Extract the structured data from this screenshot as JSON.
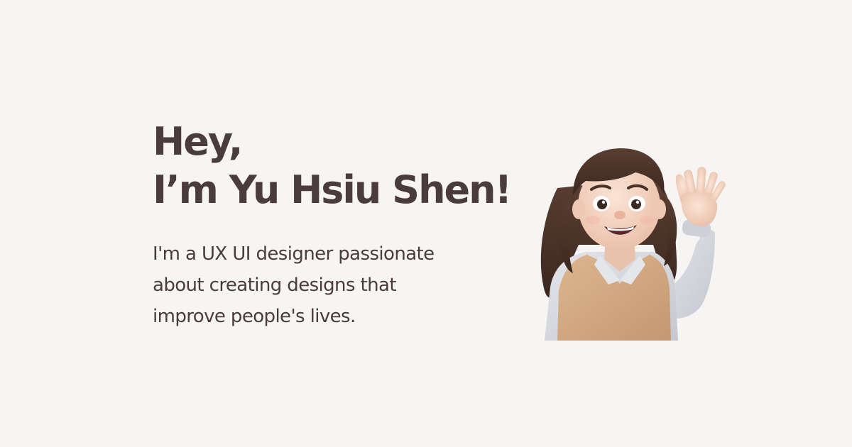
{
  "hero": {
    "greeting_line1": "Hey,",
    "greeting_line2": "I’m Yu Hsiu Shen!",
    "tagline_lines": [
      "I'm a UX UI designer passionate",
      "about creating designs that",
      "improve people's lives."
    ]
  },
  "avatar": {
    "icon": "memoji-waving-avatar-icon"
  },
  "colors": {
    "background": "#f7f5f4",
    "text": "#4a3b3c",
    "hair": "#4b3329",
    "vest": "#d4ad85",
    "shirt": "#d7d9de",
    "skin": "#f6d7c6"
  }
}
